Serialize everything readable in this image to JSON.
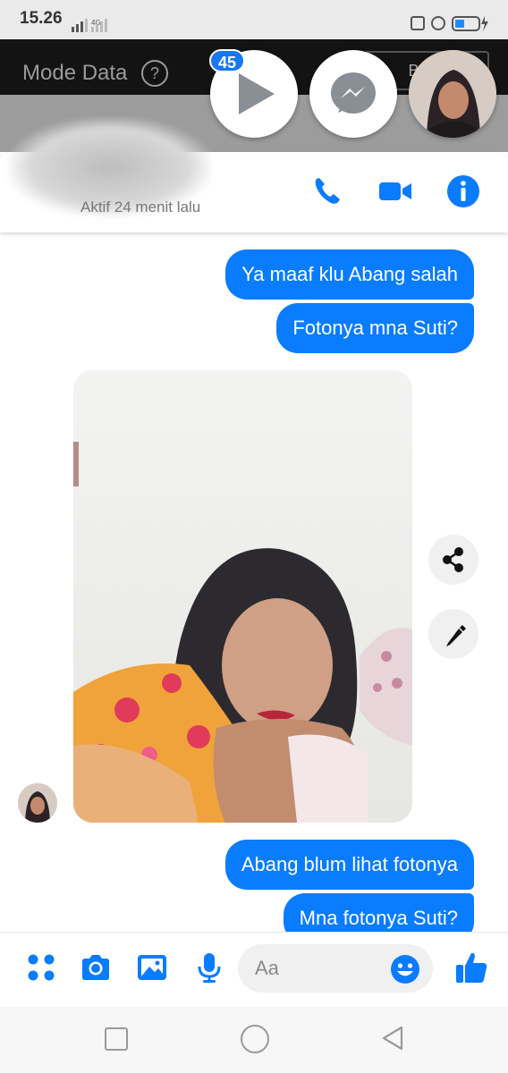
{
  "status_bar": {
    "time": "15.26",
    "network": "4G"
  },
  "app_bar": {
    "title": "Mode Data",
    "help_icon": "?",
    "action_label": "Buka"
  },
  "chat_heads": {
    "unread_badge": "45"
  },
  "chat_header": {
    "contact_name": "",
    "active_status": "Aktif 24 menit lalu"
  },
  "messages": [
    {
      "text": "Ya maaf klu Abang salah",
      "direction": "outgoing"
    },
    {
      "text": "Fotonya mna Suti?",
      "direction": "outgoing"
    },
    {
      "type": "photo",
      "direction": "incoming"
    },
    {
      "text": "Abang blum lihat fotonya",
      "direction": "outgoing"
    },
    {
      "text": "Mna fotonya Suti?",
      "direction": "outgoing"
    }
  ],
  "composer": {
    "placeholder": "Aa"
  },
  "icons": {
    "call": "phone-icon",
    "video": "video-camera-icon",
    "info": "info-icon",
    "share": "share-icon",
    "edit": "pencil-icon",
    "apps": "apps-icon",
    "camera": "camera-icon",
    "gallery": "image-icon",
    "mic": "microphone-icon",
    "emoji": "emoji-icon",
    "like": "thumbs-up-icon"
  },
  "colors": {
    "accent": "#0a7cff",
    "bubble_text": "#ffffff"
  }
}
